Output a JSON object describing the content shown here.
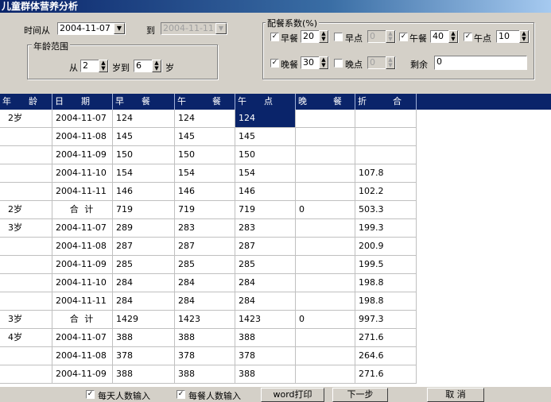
{
  "window": {
    "title": "儿童群体营养分析"
  },
  "filters": {
    "time_from_label": "时间从",
    "date_from": "2004-11-07",
    "to_label": "到",
    "date_to": "2004-11-11",
    "age_group_title": "年龄范围",
    "age_from_label": "从",
    "age_from": "2",
    "age_mid_label": "岁到",
    "age_to": "6",
    "age_end_label": "岁"
  },
  "coefficients": {
    "title": "配餐系数(%)",
    "breakfast": {
      "label": "早餐",
      "value": "20",
      "checked": "✓"
    },
    "morning_snack": {
      "label": "早点",
      "value": "0",
      "checked": ""
    },
    "lunch": {
      "label": "午餐",
      "value": "40",
      "checked": "✓"
    },
    "afternoon_snack": {
      "label": "午点",
      "value": "10",
      "checked": "✓"
    },
    "dinner": {
      "label": "晚餐",
      "value": "30",
      "checked": "✓"
    },
    "evening_snack": {
      "label": "晚点",
      "value": "0",
      "checked": ""
    },
    "remainder_label": "剩余",
    "remainder": "0"
  },
  "grid": {
    "headers": [
      "年　　龄",
      "日　　期",
      "早　　餐",
      "午　　　餐",
      "午　　点",
      "晚　　　餐",
      "折　　　合"
    ],
    "rows": [
      [
        "2岁",
        "2004-11-07",
        "124",
        "124",
        "124",
        "",
        ""
      ],
      [
        "",
        "2004-11-08",
        "145",
        "145",
        "145",
        "",
        ""
      ],
      [
        "",
        "2004-11-09",
        "150",
        "150",
        "150",
        "",
        ""
      ],
      [
        "",
        "2004-11-10",
        "154",
        "154",
        "154",
        "",
        "107.8"
      ],
      [
        "",
        "2004-11-11",
        "146",
        "146",
        "146",
        "",
        "102.2"
      ],
      [
        "2岁",
        "合 计",
        "719",
        "719",
        "719",
        "0",
        "503.3"
      ],
      [
        "3岁",
        "2004-11-07",
        "289",
        "283",
        "283",
        "",
        "199.3"
      ],
      [
        "",
        "2004-11-08",
        "287",
        "287",
        "287",
        "",
        "200.9"
      ],
      [
        "",
        "2004-11-09",
        "285",
        "285",
        "285",
        "",
        "199.5"
      ],
      [
        "",
        "2004-11-10",
        "284",
        "284",
        "284",
        "",
        "198.8"
      ],
      [
        "",
        "2004-11-11",
        "284",
        "284",
        "284",
        "",
        "198.8"
      ],
      [
        "3岁",
        "合 计",
        "1429",
        "1423",
        "1423",
        "0",
        "997.3"
      ],
      [
        "4岁",
        "2004-11-07",
        "388",
        "388",
        "388",
        "",
        "271.6"
      ],
      [
        "",
        "2004-11-08",
        "378",
        "378",
        "378",
        "",
        "264.6"
      ],
      [
        "",
        "2004-11-09",
        "388",
        "388",
        "388",
        "",
        "271.6"
      ]
    ]
  },
  "bottom": {
    "daily_input_label": "每天人数输入",
    "daily_input_checked": "✓",
    "meal_input_label": "每餐人数输入",
    "meal_input_checked": "✓",
    "word_print_label": "word打印",
    "next_label": "下一步",
    "cancel_label": "取 消"
  }
}
